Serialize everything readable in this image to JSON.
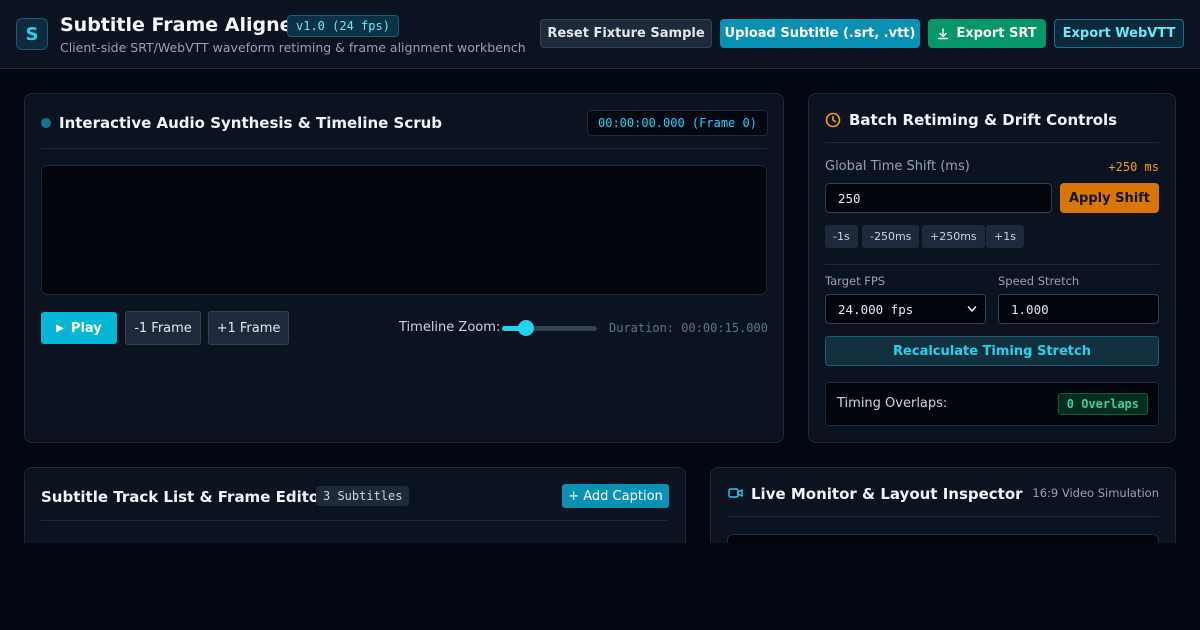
{
  "header": {
    "logo_letter": "S",
    "title": "Subtitle Frame Aligner",
    "version": "v1.0 (24 fps)",
    "subtitle": "Client-side SRT/WebVTT waveform retiming & frame alignment workbench",
    "buttons": {
      "reset": "Reset Fixture Sample",
      "upload": "Upload Subtitle (.srt, .vtt)",
      "export_srt": "Export SRT",
      "export_vtt": "Export WebVTT"
    }
  },
  "audio_panel": {
    "title": "Interactive Audio Synthesis & Timeline Scrub",
    "timecode": "00:00:00.000 (Frame 0)",
    "play_label": "Play",
    "prev_frame_label": "-1 Frame",
    "next_frame_label": "+1 Frame",
    "zoom_label": "Timeline Zoom:",
    "zoom_level": 0.25,
    "duration_label": "Duration: 00:00:15.000"
  },
  "batch_panel": {
    "title": "Batch Retiming & Drift Controls",
    "shift_label": "Global Time Shift (ms)",
    "shift_display": "+250 ms",
    "shift_input_value": "250",
    "apply_label": "Apply Shift",
    "presets": [
      "-1s",
      "-250ms",
      "+250ms",
      "+1s"
    ],
    "target_fps_label": "Target FPS",
    "target_fps_value": "24.000 fps",
    "speed_stretch_label": "Speed Stretch",
    "speed_stretch_value": "1.000",
    "recalc_label": "Recalculate Timing Stretch",
    "overlaps_label": "Timing Overlaps:",
    "overlaps_value": "0 Overlaps"
  },
  "track_panel": {
    "title": "Subtitle Track List & Frame Editor",
    "count": "3 Subtitles",
    "add_label": "+ Add Caption"
  },
  "monitor_panel": {
    "title": "Live Monitor & Layout Inspector",
    "aspect": "16:9 Video Simulation"
  },
  "colors": {
    "background": "#030712",
    "panel": "#0b1220",
    "accent": "#22d3ee",
    "primary_button": "#0891b2",
    "success": "#059669",
    "warning": "#d97706"
  },
  "icons": {
    "logo": "s-logo-icon",
    "download": "download-icon",
    "status_dot": "status-dot-icon",
    "clock": "clock-icon",
    "play": "play-icon",
    "dropdown": "chevron-down-icon",
    "video": "video-camera-icon"
  }
}
